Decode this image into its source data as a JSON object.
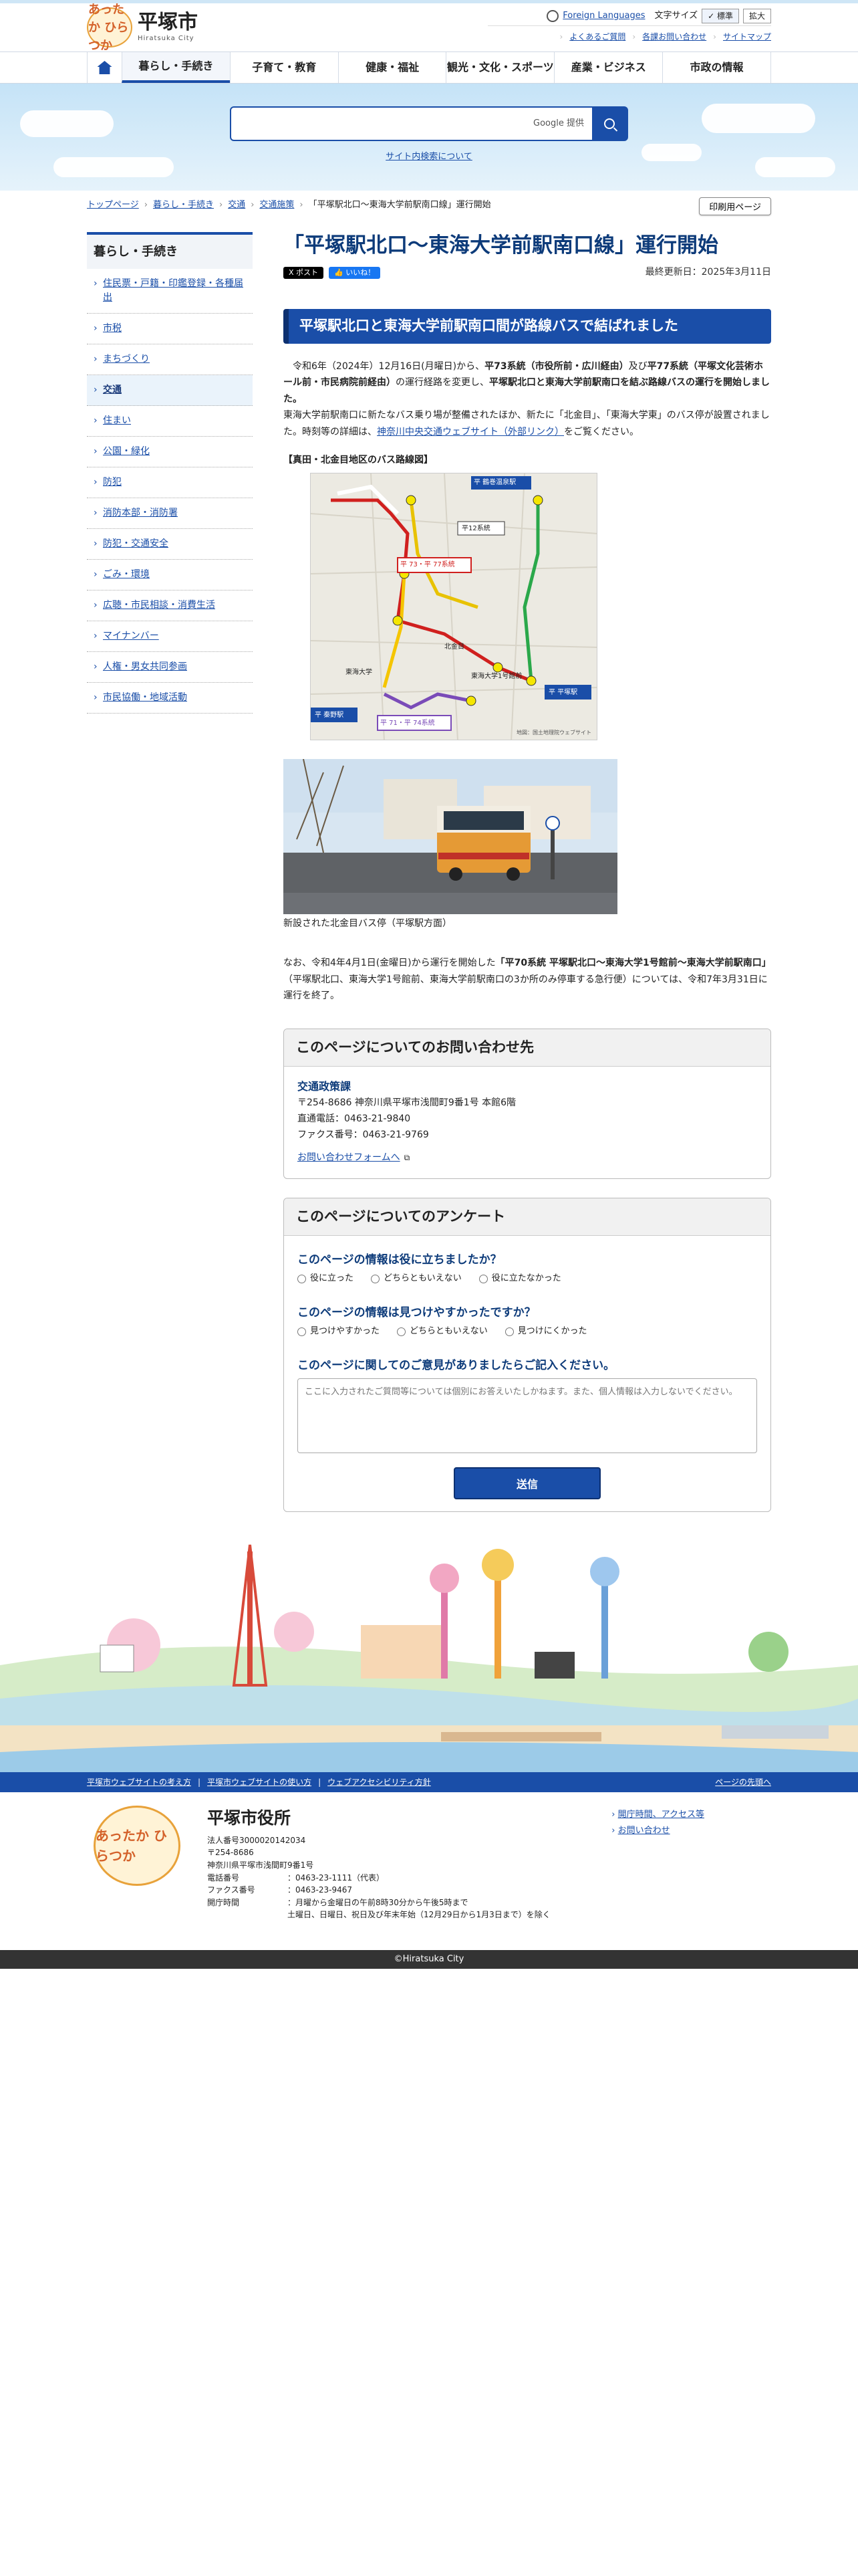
{
  "header": {
    "logo_mark": "あったか ひらつか",
    "logo_name": "平塚市",
    "logo_sub": "Hiratsuka City",
    "foreign_languages": "Foreign Languages",
    "font_size_label": "文字サイズ",
    "font_standard": "✓ 標準",
    "font_large": "拡大",
    "faq": "よくあるご質問",
    "inquiries": "各課お問い合わせ",
    "sitemap": "サイトマップ"
  },
  "nav": {
    "items": [
      {
        "label": "暮らし・手続き"
      },
      {
        "label": "子育て・教育"
      },
      {
        "label": "健康・福祉"
      },
      {
        "label": "観光・文化・スポーツ"
      },
      {
        "label": "産業・ビジネス"
      },
      {
        "label": "市政の情報"
      }
    ]
  },
  "search": {
    "placeholder": "",
    "google_label": "Google 提供",
    "help_link": "サイト内検索について"
  },
  "breadcrumb": {
    "items": [
      "トップページ",
      "暮らし・手続き",
      "交通",
      "交通施策"
    ],
    "current": "「平塚駅北口〜東海大学前駅南口線」運行開始",
    "print_button": "印刷用ページ"
  },
  "sidebar": {
    "heading": "暮らし・手続き",
    "items": [
      {
        "label": "住民票・戸籍・印鑑登録・各種届出"
      },
      {
        "label": "市税"
      },
      {
        "label": "まちづくり"
      },
      {
        "label": "交通"
      },
      {
        "label": "住まい"
      },
      {
        "label": "公園・緑化"
      },
      {
        "label": "防犯"
      },
      {
        "label": "消防本部・消防署"
      },
      {
        "label": "防犯・交通安全"
      },
      {
        "label": "ごみ・環境"
      },
      {
        "label": "広聴・市民相談・消費生活"
      },
      {
        "label": "マイナンバー"
      },
      {
        "label": "人権・男女共同参画"
      },
      {
        "label": "市民協働・地域活動"
      }
    ]
  },
  "article": {
    "title": "「平塚駅北口〜東海大学前駅南口線」運行開始",
    "share_x": "X ポスト",
    "share_fb": "👍 いいね！",
    "updated": "最終更新日：2025年3月11日",
    "h2": "平塚駅北口と東海大学前駅南口間が路線バスで結ばれました",
    "p1_a": "令和6年（2024年）12月16日(月曜日)から、",
    "p1_b": "平73系統（市役所前・広川経由）",
    "p1_c": "及び",
    "p1_d": "平77系統（平塚文化芸術ホール前・市民病院前経由）",
    "p1_e": "の運行経路を変更し、",
    "p1_f": "平塚駅北口と東海大学前駅南口を結ぶ路線バスの運行を開始しました。",
    "p2_a": "東海大学前駅南口に新たなバス乗り場が整備されたほか、新たに「北金目」、「東海大学東」のバス停が設置されました。時刻等の詳細は、",
    "p2_link": "神奈川中央交通ウェブサイト（外部リンク）",
    "p2_b": "をご覧ください。",
    "map_caption": "【真田・北金目地区のバス路線図】",
    "photo_caption": "新設された北金目バス停（平塚駅方面）",
    "p3_a": "なお、令和4年4月1日(金曜日)から運行を開始した",
    "p3_b": "「平70系統 平塚駅北口〜東海大学1号館前〜東海大学前駅南口」",
    "p3_c": "（平塚駅北口、東海大学1号館前、東海大学前駅南口の3か所のみ停車する急行便）については、令和7年3月31日に運行を終了。"
  },
  "map": {
    "labels": {
      "north": "平 鶴巻温泉駅",
      "line12": "平12系統",
      "line73": "平 73・平 77系統",
      "line71": "平 71・平 74系統",
      "hadano": "平 秦野駅",
      "hiratsuka": "平 平塚駅",
      "north_kaname": "北金目",
      "tokai": "東海大学",
      "route_a": "東海大学1号館前",
      "note": "地図：国土地理院ウェブサイト"
    }
  },
  "contact": {
    "heading": "このページについてのお問い合わせ先",
    "dept": "交通政策課",
    "address": "〒254-8686 神奈川県平塚市浅間町9番1号 本館6階",
    "tel": "直通電話：0463-21-9840",
    "fax": "ファクス番号：0463-21-9769",
    "form_link": "お問い合わせフォームへ"
  },
  "survey": {
    "heading": "このページについてのアンケート",
    "q1": "このページの情報は役に立ちましたか？",
    "q1_opts": [
      "役に立った",
      "どちらともいえない",
      "役に立たなかった"
    ],
    "q2": "このページの情報は見つけやすかったですか？",
    "q2_opts": [
      "見つけやすかった",
      "どちらともいえない",
      "見つけにくかった"
    ],
    "q3": "このページに関してのご意見がありましたらご記入ください。",
    "comment_placeholder": "ここに入力されたご質問等については個別にお答えいたしかねます。また、個人情報は入力しないでください。",
    "submit": "送信"
  },
  "footer": {
    "links": [
      "平塚市ウェブサイトの考え方",
      "平塚市ウェブサイトの使い方",
      "ウェブアクセシビリティ方針"
    ],
    "pagetop": "ページの先頭へ",
    "name": "平塚市役所",
    "corp_no": "法人番号3000020142034",
    "zip": "〒254-8686",
    "addr": "神奈川県平塚市浅間町9番1号",
    "tel_k": "電話番号",
    "tel_v": "：0463-23-1111（代表）",
    "fax_k": "ファクス番号",
    "fax_v": "：0463-23-9467",
    "hours_k": "開庁時間",
    "hours_v1": "：月曜から金曜日の午前8時30分から午後5時まで",
    "hours_v2": "土曜日、日曜日、祝日及び年末年始（12月29日から1月3日まで）を除く",
    "right_links": [
      "開庁時間、アクセス等",
      "お問い合わせ"
    ],
    "copyright": "©Hiratsuka City"
  },
  "colors": {
    "accent": "#1a4ea8",
    "title": "#0d3b7a",
    "footer_bar": "#1a4ea8"
  }
}
